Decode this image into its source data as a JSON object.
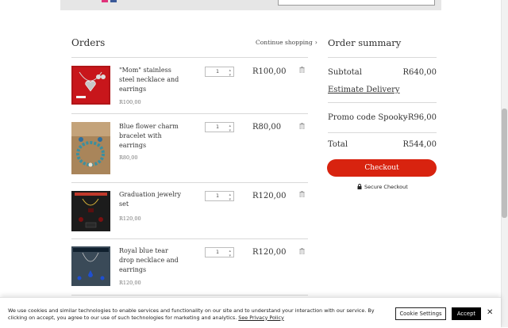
{
  "header": {
    "search_placeholder": ""
  },
  "orders": {
    "title": "Orders",
    "continue_label": "Continue shopping",
    "continue_chevron": "›",
    "items": [
      {
        "name": "\"Mom\" stainless steel necklace and earrings",
        "unit_price": "R100,00",
        "quantity": "1",
        "line_total": "R100,00"
      },
      {
        "name": "Blue flower charm bracelet with earrings",
        "unit_price": "R80,00",
        "quantity": "1",
        "line_total": "R80,00"
      },
      {
        "name": "Graduation jewelry set",
        "unit_price": "R120,00",
        "quantity": "1",
        "line_total": "R120,00"
      },
      {
        "name": "Royal blue tear drop necklace and earrings",
        "unit_price": "R120,00",
        "quantity": "1",
        "line_total": "R120,00"
      }
    ]
  },
  "summary": {
    "title": "Order summary",
    "subtotal_label": "Subtotal",
    "subtotal_value": "R640,00",
    "estimate_label": "Estimate Delivery",
    "promo_label": "Promo code Spooky",
    "promo_value": "-R96,00",
    "total_label": "Total",
    "total_value": "R544,00",
    "checkout_label": "Checkout",
    "secure_label": "Secure Checkout"
  },
  "cookie": {
    "text": "We use cookies and similar technologies to enable services and functionality on our site and to understand your interaction with our service. By clicking on accept, you agree to our use of such technologies for marketing and analytics.",
    "policy_link": "See Privacy Policy",
    "settings_label": "Cookie Settings",
    "accept_label": "Accept",
    "close_glyph": "✕"
  },
  "colors": {
    "accent": "#d8230f",
    "banner_button": "#000000"
  }
}
